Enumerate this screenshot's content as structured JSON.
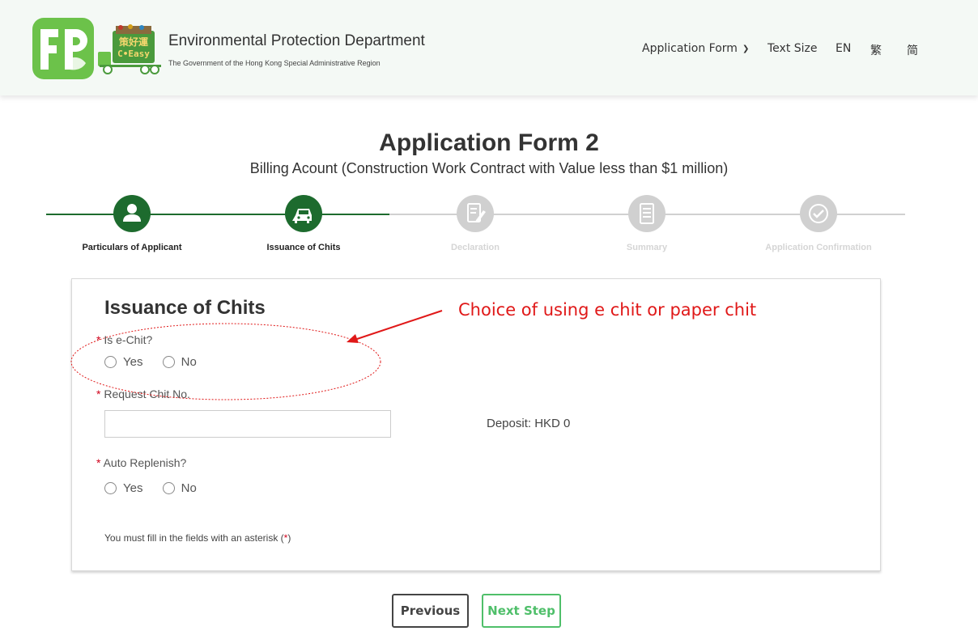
{
  "header": {
    "dept_name": "Environmental Protection Department",
    "dept_sub": "The Government of the Hong Kong Special Administrative Region",
    "ceasy_cn": "策好運",
    "ceasy_en": "C•Easy",
    "nav": {
      "application_form": "Application Form",
      "text_size": "Text Size",
      "lang_en": "EN",
      "lang_tc": "繁",
      "lang_sc": "简"
    }
  },
  "page": {
    "title": "Application Form 2",
    "subtitle": "Billing Acount (Construction Work Contract with Value less than $1 million)"
  },
  "steps": [
    {
      "label": "Particulars of Applicant",
      "state": "done",
      "icon": "user-icon"
    },
    {
      "label": "Issuance of Chits",
      "state": "active",
      "icon": "car-icon"
    },
    {
      "label": "Declaration",
      "state": "pending",
      "icon": "edit-document-icon"
    },
    {
      "label": "Summary",
      "state": "pending",
      "icon": "list-document-icon"
    },
    {
      "label": "Application Confirmation",
      "state": "pending",
      "icon": "check-circle-icon"
    }
  ],
  "form": {
    "section_title": "Issuance of Chits",
    "asterisk": "*",
    "is_echit_label": "Is e-Chit?",
    "yes": "Yes",
    "no": "No",
    "request_chit_label": "Request Chit No.",
    "request_chit_value": "",
    "deposit": "Deposit: HKD 0",
    "auto_replenish_label": "Auto Replenish?",
    "note_prefix": "You must fill in the fields with an asterisk (",
    "note_star": "*",
    "note_suffix": ")"
  },
  "annotation": {
    "text": "Choice of using e chit or paper chit"
  },
  "buttons": {
    "previous": "Previous",
    "next": "Next Step"
  },
  "colors": {
    "active_green": "#1d6b2e",
    "pending_grey": "#d0d0d0",
    "annotation_red": "#e01818",
    "next_green": "#4fbf6a"
  }
}
